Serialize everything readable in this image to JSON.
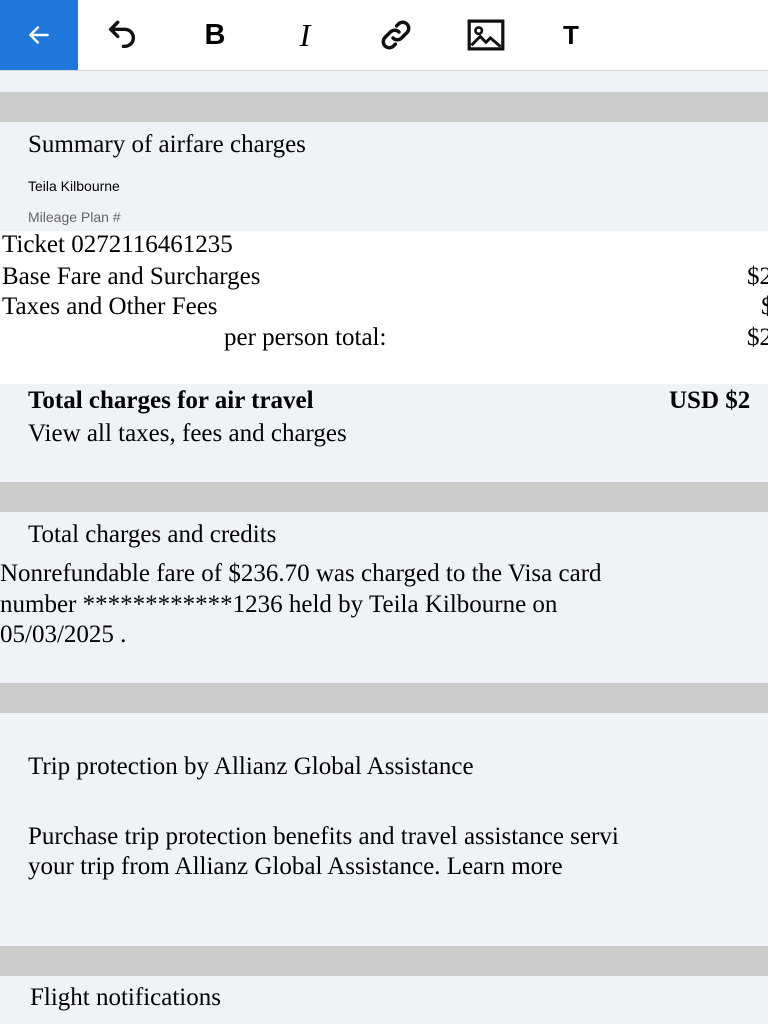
{
  "toolbar": {
    "accent_color": "#1e77d9",
    "buttons": [
      {
        "name": "back",
        "icon": "arrow-left-icon"
      },
      {
        "name": "undo",
        "icon": "undo-icon"
      },
      {
        "name": "bold",
        "icon": "bold-icon",
        "label": "B"
      },
      {
        "name": "italic",
        "icon": "italic-icon",
        "label": "I"
      },
      {
        "name": "link",
        "icon": "link-icon"
      },
      {
        "name": "image",
        "icon": "image-icon"
      },
      {
        "name": "text",
        "icon": "text-icon",
        "label": "T"
      }
    ]
  },
  "summary": {
    "title": "Summary of airfare charges",
    "passenger_name": "Teila Kilbourne",
    "mileage_label": "Mileage Plan #",
    "ticket": "Ticket 0272116461235",
    "base_fare_label": "Base Fare and Surcharges",
    "base_fare_value": "$2",
    "taxes_label": "Taxes and Other Fees",
    "taxes_value": "$",
    "per_person_label": "per person total:",
    "per_person_value": "$2",
    "total_label": "Total charges for air travel",
    "total_value": "USD $2",
    "view_all_link": "View all taxes, fees and charges"
  },
  "credits": {
    "title": "Total charges and credits",
    "line1": "Nonrefundable fare of $236.70 was  charged to the Visa card",
    "line2": "number ************1236  held by Teila Kilbourne on",
    "line3": "05/03/2025 ."
  },
  "protection": {
    "title": "Trip protection by Allianz Global Assistance",
    "line1": "Purchase trip protection benefits and travel assistance servi",
    "line2_prefix": "your trip from Allianz Global Assistance.",
    "learn_more": "Learn more"
  },
  "notifications": {
    "title": "Flight notifications"
  }
}
